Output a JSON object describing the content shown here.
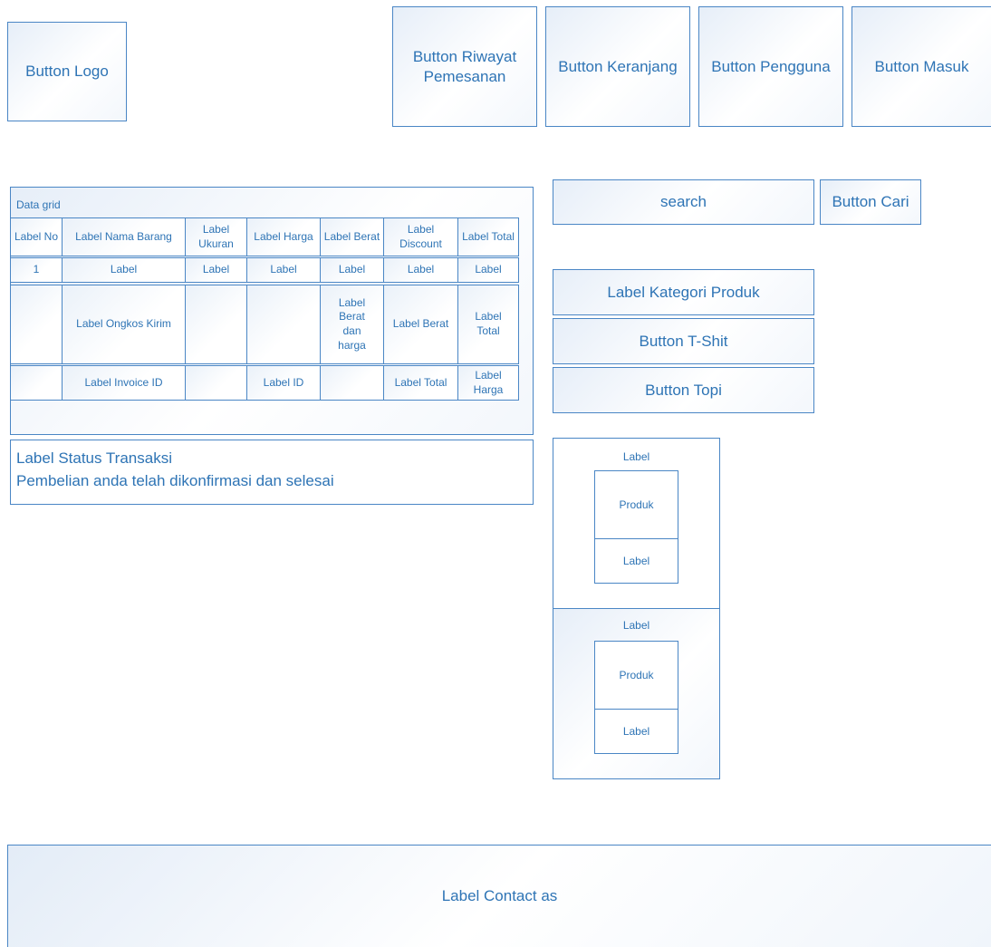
{
  "header": {
    "logo_label": "Button Logo",
    "riwayat_label": "Button Riwayat Pemesanan",
    "keranjang_label": "Button Keranjang",
    "pengguna_label": "Button Pengguna",
    "masuk_label": "Button Masuk"
  },
  "search": {
    "placeholder": "search",
    "button_label": "Button Cari"
  },
  "grid": {
    "title": "Data grid",
    "headers": [
      "Label No",
      "Label Nama Barang",
      "Label Ukuran",
      "Label Harga",
      "Label Berat",
      "Label Discount",
      "Label Total"
    ],
    "row1": [
      "1",
      "Label",
      "Label",
      "Label",
      "Label",
      "Label",
      "Label"
    ],
    "row2": {
      "ongkos": "Label Ongkos Kirim",
      "berat_harga": "Label Berat dan harga",
      "berat": "Label Berat",
      "total": "Label Total"
    },
    "row3": {
      "invoice": "Label Invoice ID",
      "id": "Label ID",
      "total": "Label Total",
      "harga": "Label Harga"
    }
  },
  "status": {
    "label": "Label Status Transaksi",
    "message": "Pembelian anda telah dikonfirmasi dan selesai"
  },
  "categories": {
    "title": "Label Kategori Produk",
    "tshirt_label": "Button T-Shit",
    "topi_label": "Button Topi"
  },
  "products": [
    {
      "label": "Label",
      "image_label": "Produk",
      "caption": "Label"
    },
    {
      "label": "Label",
      "image_label": "Produk",
      "caption": "Label"
    }
  ],
  "footer": {
    "contact_label": "Label Contact as"
  }
}
